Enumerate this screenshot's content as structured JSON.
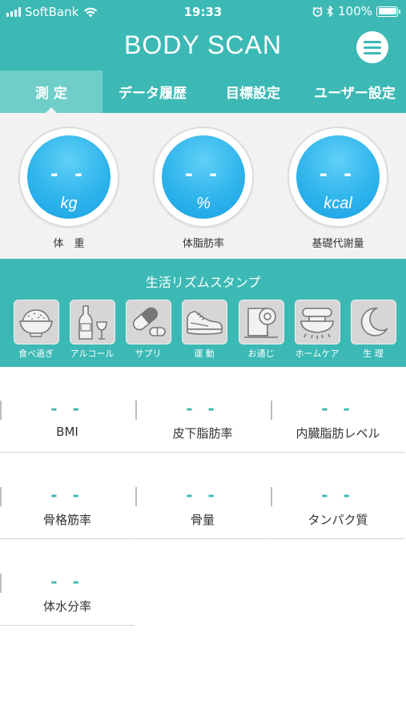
{
  "status_bar": {
    "carrier": "SoftBank",
    "time": "19:33",
    "battery": "100%",
    "battery_level": 1.0
  },
  "header": {
    "title": "BODY SCAN",
    "menu_icon": "hamburger-menu-icon"
  },
  "tabs": [
    {
      "label": "測 定",
      "active": true
    },
    {
      "label": "データ履歴",
      "active": false
    },
    {
      "label": "目標設定",
      "active": false
    },
    {
      "label": "ユーザー設定",
      "active": false
    }
  ],
  "gauges": [
    {
      "value": "- -",
      "unit": "kg",
      "label": "体　重"
    },
    {
      "value": "- -",
      "unit": "%",
      "label": "体脂肪率"
    },
    {
      "value": "- -",
      "unit": "kcal",
      "label": "基礎代謝量"
    }
  ],
  "stamps": {
    "title": "生活リズムスタンプ",
    "items": [
      {
        "label": "食べ過ぎ",
        "icon": "rice-bowl-icon"
      },
      {
        "label": "アルコール",
        "icon": "bottle-glass-icon"
      },
      {
        "label": "サプリ",
        "icon": "capsule-icon"
      },
      {
        "label": "運 動",
        "icon": "sneaker-icon"
      },
      {
        "label": "お通じ",
        "icon": "toilet-paper-icon"
      },
      {
        "label": "ホームケア",
        "icon": "massager-icon"
      },
      {
        "label": "生 理",
        "icon": "crescent-moon-icon"
      }
    ]
  },
  "metrics": [
    {
      "value": "- -",
      "label": "BMI"
    },
    {
      "value": "- -",
      "label": "皮下脂肪率"
    },
    {
      "value": "- -",
      "label": "内臓脂肪レベル"
    },
    {
      "value": "- -",
      "label": "骨格筋率"
    },
    {
      "value": "- -",
      "label": "骨量"
    },
    {
      "value": "- -",
      "label": "タンパク質"
    },
    {
      "value": "- -",
      "label": "体水分率"
    }
  ],
  "colors": {
    "accent": "#3cb9b5",
    "tab_active": "#70cec9",
    "gauge_blue": "#2fb4ec",
    "stamp_bg": "#d6d6d6",
    "panel_bg": "#f2f2f2"
  }
}
